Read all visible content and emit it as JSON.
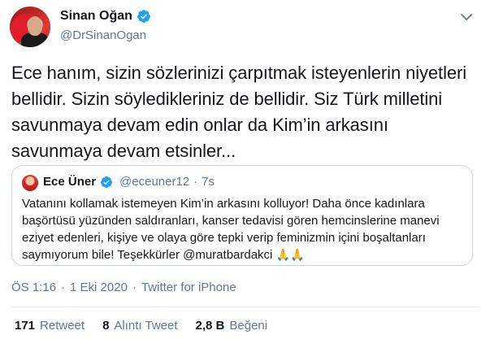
{
  "author": {
    "display_name": "Sinan Oğan",
    "handle": "@DrSinanOgan"
  },
  "tweet": {
    "text": "Ece hanım, sizin sözlerinizi çarpıtmak isteyenlerin niyetleri bellidir. Sizin söyledikleriniz de bellidir. Siz Türk milletini savunmaya devam edin onlar da Kim’in arkasını savunmaya devam etsinler..."
  },
  "quoted_tweet": {
    "display_name": "Ece Üner",
    "handle": "@eceuner12",
    "separator": "·",
    "time": "7s",
    "text_main": "Vatanını kollamak istemeyen Kim’in arkasını kolluyor! Daha önce kadınlara başörtüsü yüzünden saldıranları, kanser tedavisi gören hemcinslerine manevi eziyet edenleri, kişiye ve olaya göre tepki verip feminizmin içini boşaltanları saymıyorum bile! Teşekkürler @muratbardakci",
    "emoji": "🙏🙏"
  },
  "meta": {
    "time": "ÖS 1:16",
    "separator1": "·",
    "date": "1 Eki 2020",
    "separator2": "·",
    "source": "Twitter for iPhone"
  },
  "stats": {
    "retweets_count": "171",
    "retweets_label": "Retweet",
    "quotes_count": "8",
    "quotes_label": "Alıntı Tweet",
    "likes_count": "2,8 B",
    "likes_label": "Beğeni"
  },
  "icons": {
    "verified": "verified-badge-icon",
    "chevron": "chevron-down-icon"
  },
  "colors": {
    "verified": "#1da1f2",
    "secondary_text": "#657786",
    "primary_text": "#14171a",
    "border": "#ccd6dd"
  }
}
